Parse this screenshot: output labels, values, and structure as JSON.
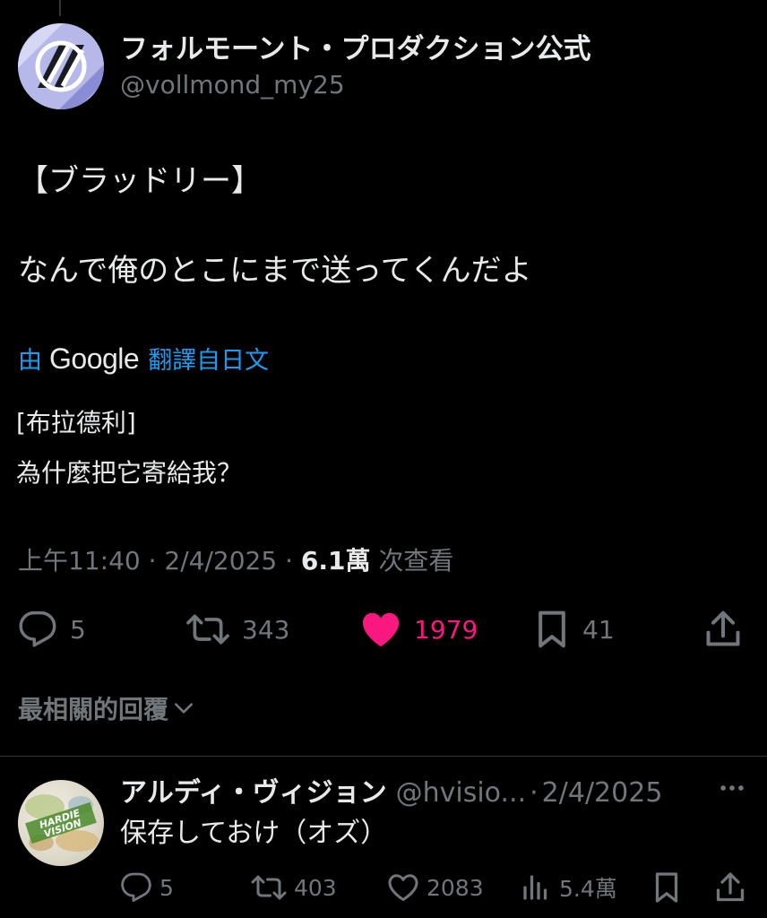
{
  "tweet": {
    "author": {
      "display_name": "フォルモーント・プロダクション公式",
      "handle": "@vollmond_my25",
      "avatar_icon": "vollmond-logo-avatar"
    },
    "text_lines": [
      "【ブラッドリー】",
      "なんで俺のとこにまで送ってくんだよ"
    ],
    "translation": {
      "prefix": "由",
      "provider": "Google",
      "suffix": "翻譯自日文",
      "lines": [
        "[布拉德利]",
        "為什麼把它寄給我？"
      ]
    },
    "meta": {
      "time": "上午11:40",
      "date": "2/4/2025",
      "separator": "·",
      "views_count": "6.1萬",
      "views_label": "次查看"
    },
    "actions": {
      "replies": "5",
      "retweets": "343",
      "likes": "1979",
      "bookmarks": "41"
    }
  },
  "replies_sort": {
    "label": "最相關的回覆"
  },
  "reply": {
    "display_name": "アルディ・ヴィジョン",
    "handle": "@hvisio...",
    "separator": "·",
    "date": "2/4/2025",
    "text": "保存しておけ（オズ）",
    "avatar_icon": "hardie-vision-logo-avatar",
    "actions": {
      "replies": "5",
      "retweets": "403",
      "likes": "2083",
      "views": "5.4萬"
    }
  },
  "colors": {
    "background": "#000000",
    "text_primary": "#e7e9ea",
    "text_secondary": "#71767b",
    "link": "#1d9bf0",
    "like_active": "#f91880",
    "divider": "#2f3336"
  }
}
